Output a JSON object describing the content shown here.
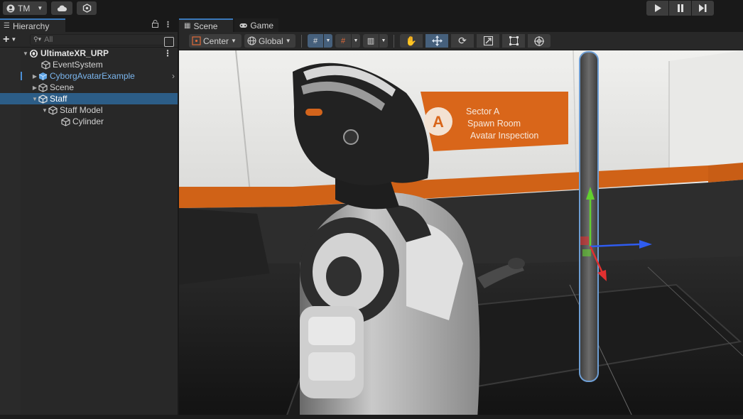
{
  "toolbar": {
    "account_label": "TM",
    "account_icon": "user-icon",
    "cloud_icon": "cloud-icon",
    "collab_icon": "collab-icon",
    "play_icon": "play-icon",
    "pause_icon": "pause-icon",
    "step_icon": "step-icon"
  },
  "hierarchy": {
    "tab_label": "Hierarchy",
    "add_label": "+",
    "search_placeholder": "All",
    "items": [
      {
        "label": "UltimateXR_URP",
        "kind": "scene-root"
      },
      {
        "label": "EventSystem",
        "kind": "gameobject"
      },
      {
        "label": "CyborgAvatarExample",
        "kind": "prefab"
      },
      {
        "label": "Scene",
        "kind": "gameobject"
      },
      {
        "label": "Staff",
        "kind": "gameobject",
        "selected": true
      },
      {
        "label": "Staff Model",
        "kind": "gameobject"
      },
      {
        "label": "Cylinder",
        "kind": "gameobject"
      }
    ]
  },
  "scene": {
    "tabs": [
      {
        "label": "Scene",
        "active": true,
        "icon": "scene-grid-icon"
      },
      {
        "label": "Game",
        "active": false,
        "icon": "gamepad-icon"
      }
    ],
    "pivot_label": "Center",
    "space_label": "Global",
    "sign": {
      "letter": "A",
      "line1": "Sector A",
      "line2": "Spawn Room",
      "line3": "Avatar Inspection"
    }
  },
  "colors": {
    "accent": "#3a79bb",
    "selection": "#2c5d87",
    "prefab_text": "#7bb6ee",
    "sign_orange": "#d9661a"
  }
}
